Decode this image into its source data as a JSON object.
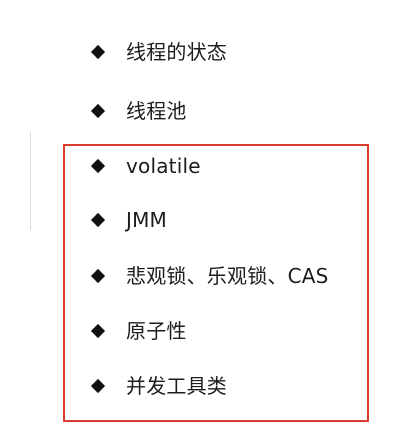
{
  "outline": {
    "items": [
      {
        "label": "线程的状态",
        "icon": "diamond-bullet-icon"
      },
      {
        "label": "线程池",
        "icon": "diamond-bullet-icon"
      },
      {
        "label": "volatile",
        "icon": "diamond-bullet-icon"
      },
      {
        "label": "JMM",
        "icon": "diamond-bullet-icon"
      },
      {
        "label": "悲观锁、乐观锁、CAS",
        "icon": "diamond-bullet-icon"
      },
      {
        "label": "原子性",
        "icon": "diamond-bullet-icon"
      },
      {
        "label": "并发工具类",
        "icon": "diamond-bullet-icon"
      }
    ]
  },
  "colors": {
    "highlight_border": "#d83a2e",
    "bullet": "#111111",
    "text": "#1c1c1c",
    "background": "#ffffff"
  }
}
